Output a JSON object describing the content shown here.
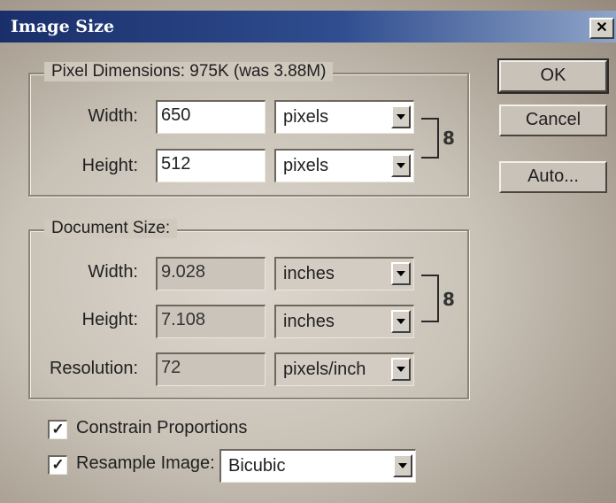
{
  "window": {
    "title": "Image Size",
    "close_glyph": "✕"
  },
  "pixel_dimensions": {
    "legend": "Pixel Dimensions:  975K (was 3.88M)",
    "width": {
      "label": "Width:",
      "value": "650",
      "unit": "pixels"
    },
    "height": {
      "label": "Height:",
      "value": "512",
      "unit": "pixels"
    },
    "link_icon": "chain-link-icon"
  },
  "document_size": {
    "legend": "Document Size:",
    "width": {
      "label": "Width:",
      "value": "9.028",
      "unit": "inches"
    },
    "height": {
      "label": "Height:",
      "value": "7.108",
      "unit": "inches"
    },
    "resolution": {
      "label": "Resolution:",
      "value": "72",
      "unit": "pixels/inch"
    },
    "link_icon": "chain-link-icon"
  },
  "options": {
    "constrain": {
      "label": "Constrain Proportions",
      "checked": true
    },
    "resample": {
      "label": "Resample Image:",
      "checked": true,
      "method": "Bicubic"
    }
  },
  "buttons": {
    "ok": "OK",
    "cancel": "Cancel",
    "auto": "Auto..."
  },
  "colors": {
    "title_bar": "#1a2f6a",
    "dialog_bg": "#cfc8bd"
  }
}
